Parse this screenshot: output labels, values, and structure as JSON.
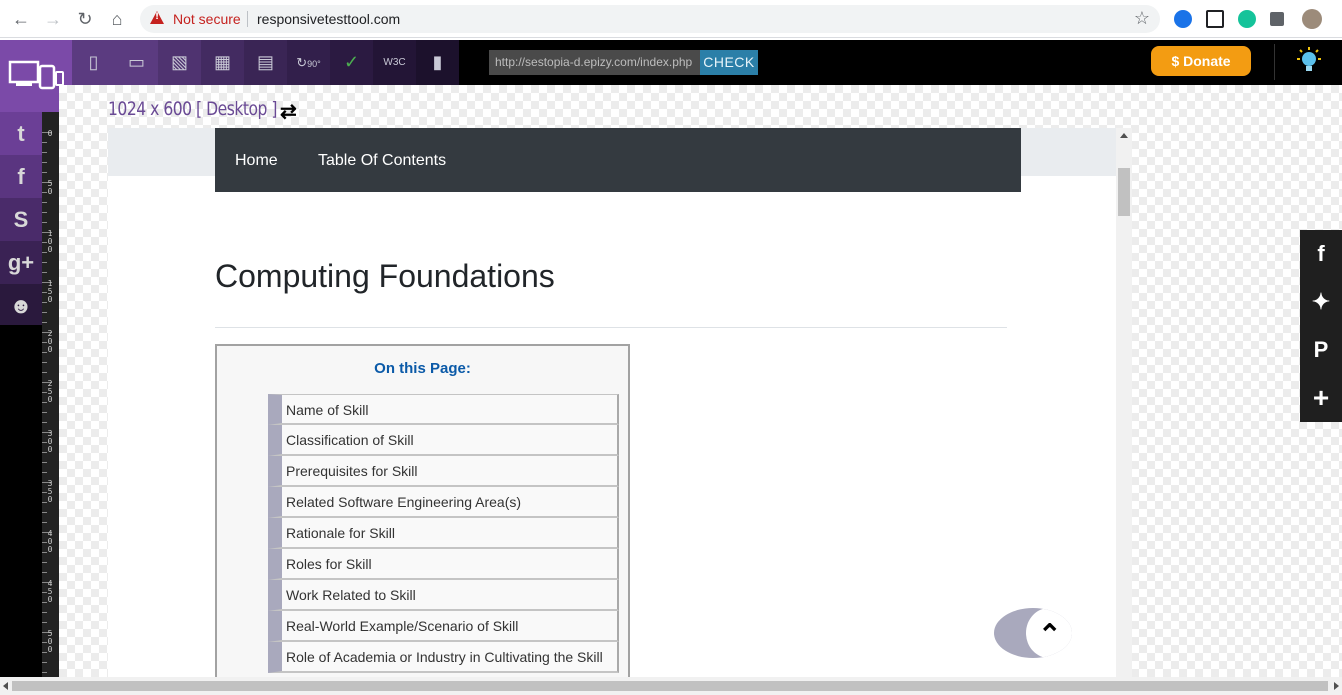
{
  "browser": {
    "security_label": "Not secure",
    "address": "responsivetesttool.com",
    "nav_icons": [
      "back-arrow-icon",
      "forward-arrow-icon",
      "reload-icon",
      "home-icon"
    ],
    "extensions": [
      "bookmark-extension-icon",
      "cast-extension-icon",
      "grammarly-extension-icon",
      "extensions-puzzle-icon",
      "profile-avatar"
    ]
  },
  "toolbar": {
    "devices": [
      "phone-icon",
      "tablet-icon",
      "desktop-icon",
      "tv-icon",
      "widescreen-icon",
      "rotate-90-icon",
      "validate-icon",
      "w3c-icon",
      "bookmark-tool-icon"
    ],
    "w3c_label": "W3C",
    "rotate_label": "90°",
    "url_value": "http://sestopia-d.epizy.com/index.php",
    "check_label": "CHECK",
    "donate_label": "$ Donate"
  },
  "left_social": [
    "twitter-icon",
    "facebook-icon",
    "skype-icon",
    "google-plus-icon",
    "user-icon"
  ],
  "ruler": {
    "labels": [
      "0",
      "50",
      "100",
      "150",
      "200",
      "250",
      "300",
      "350",
      "400",
      "450",
      "500"
    ]
  },
  "preview": {
    "resolution_label": "1024 x 600 [ Desktop ]",
    "nav": [
      "Home",
      "Table Of Contents"
    ],
    "title": "Computing Foundations",
    "toc_title": "On this Page:",
    "toc_items": [
      "Name of Skill",
      "Classification of Skill",
      "Prerequisites for Skill",
      "Related Software Engineering Area(s)",
      "Rationale for Skill",
      "Roles for Skill",
      "Work Related to Skill",
      "Real-World Example/Scenario of Skill",
      "Role of Academia or Industry in Cultivating the Skill"
    ]
  },
  "share": [
    "facebook-share-icon",
    "twitter-share-icon",
    "pinterest-share-icon",
    "more-share-icon"
  ],
  "colors": {
    "accent_purple": "#7b4aa8",
    "check_blue": "#2b7fa8",
    "donate_orange": "#f39c12",
    "navbar": "#343a40",
    "toc_title": "#0b5aa8"
  }
}
